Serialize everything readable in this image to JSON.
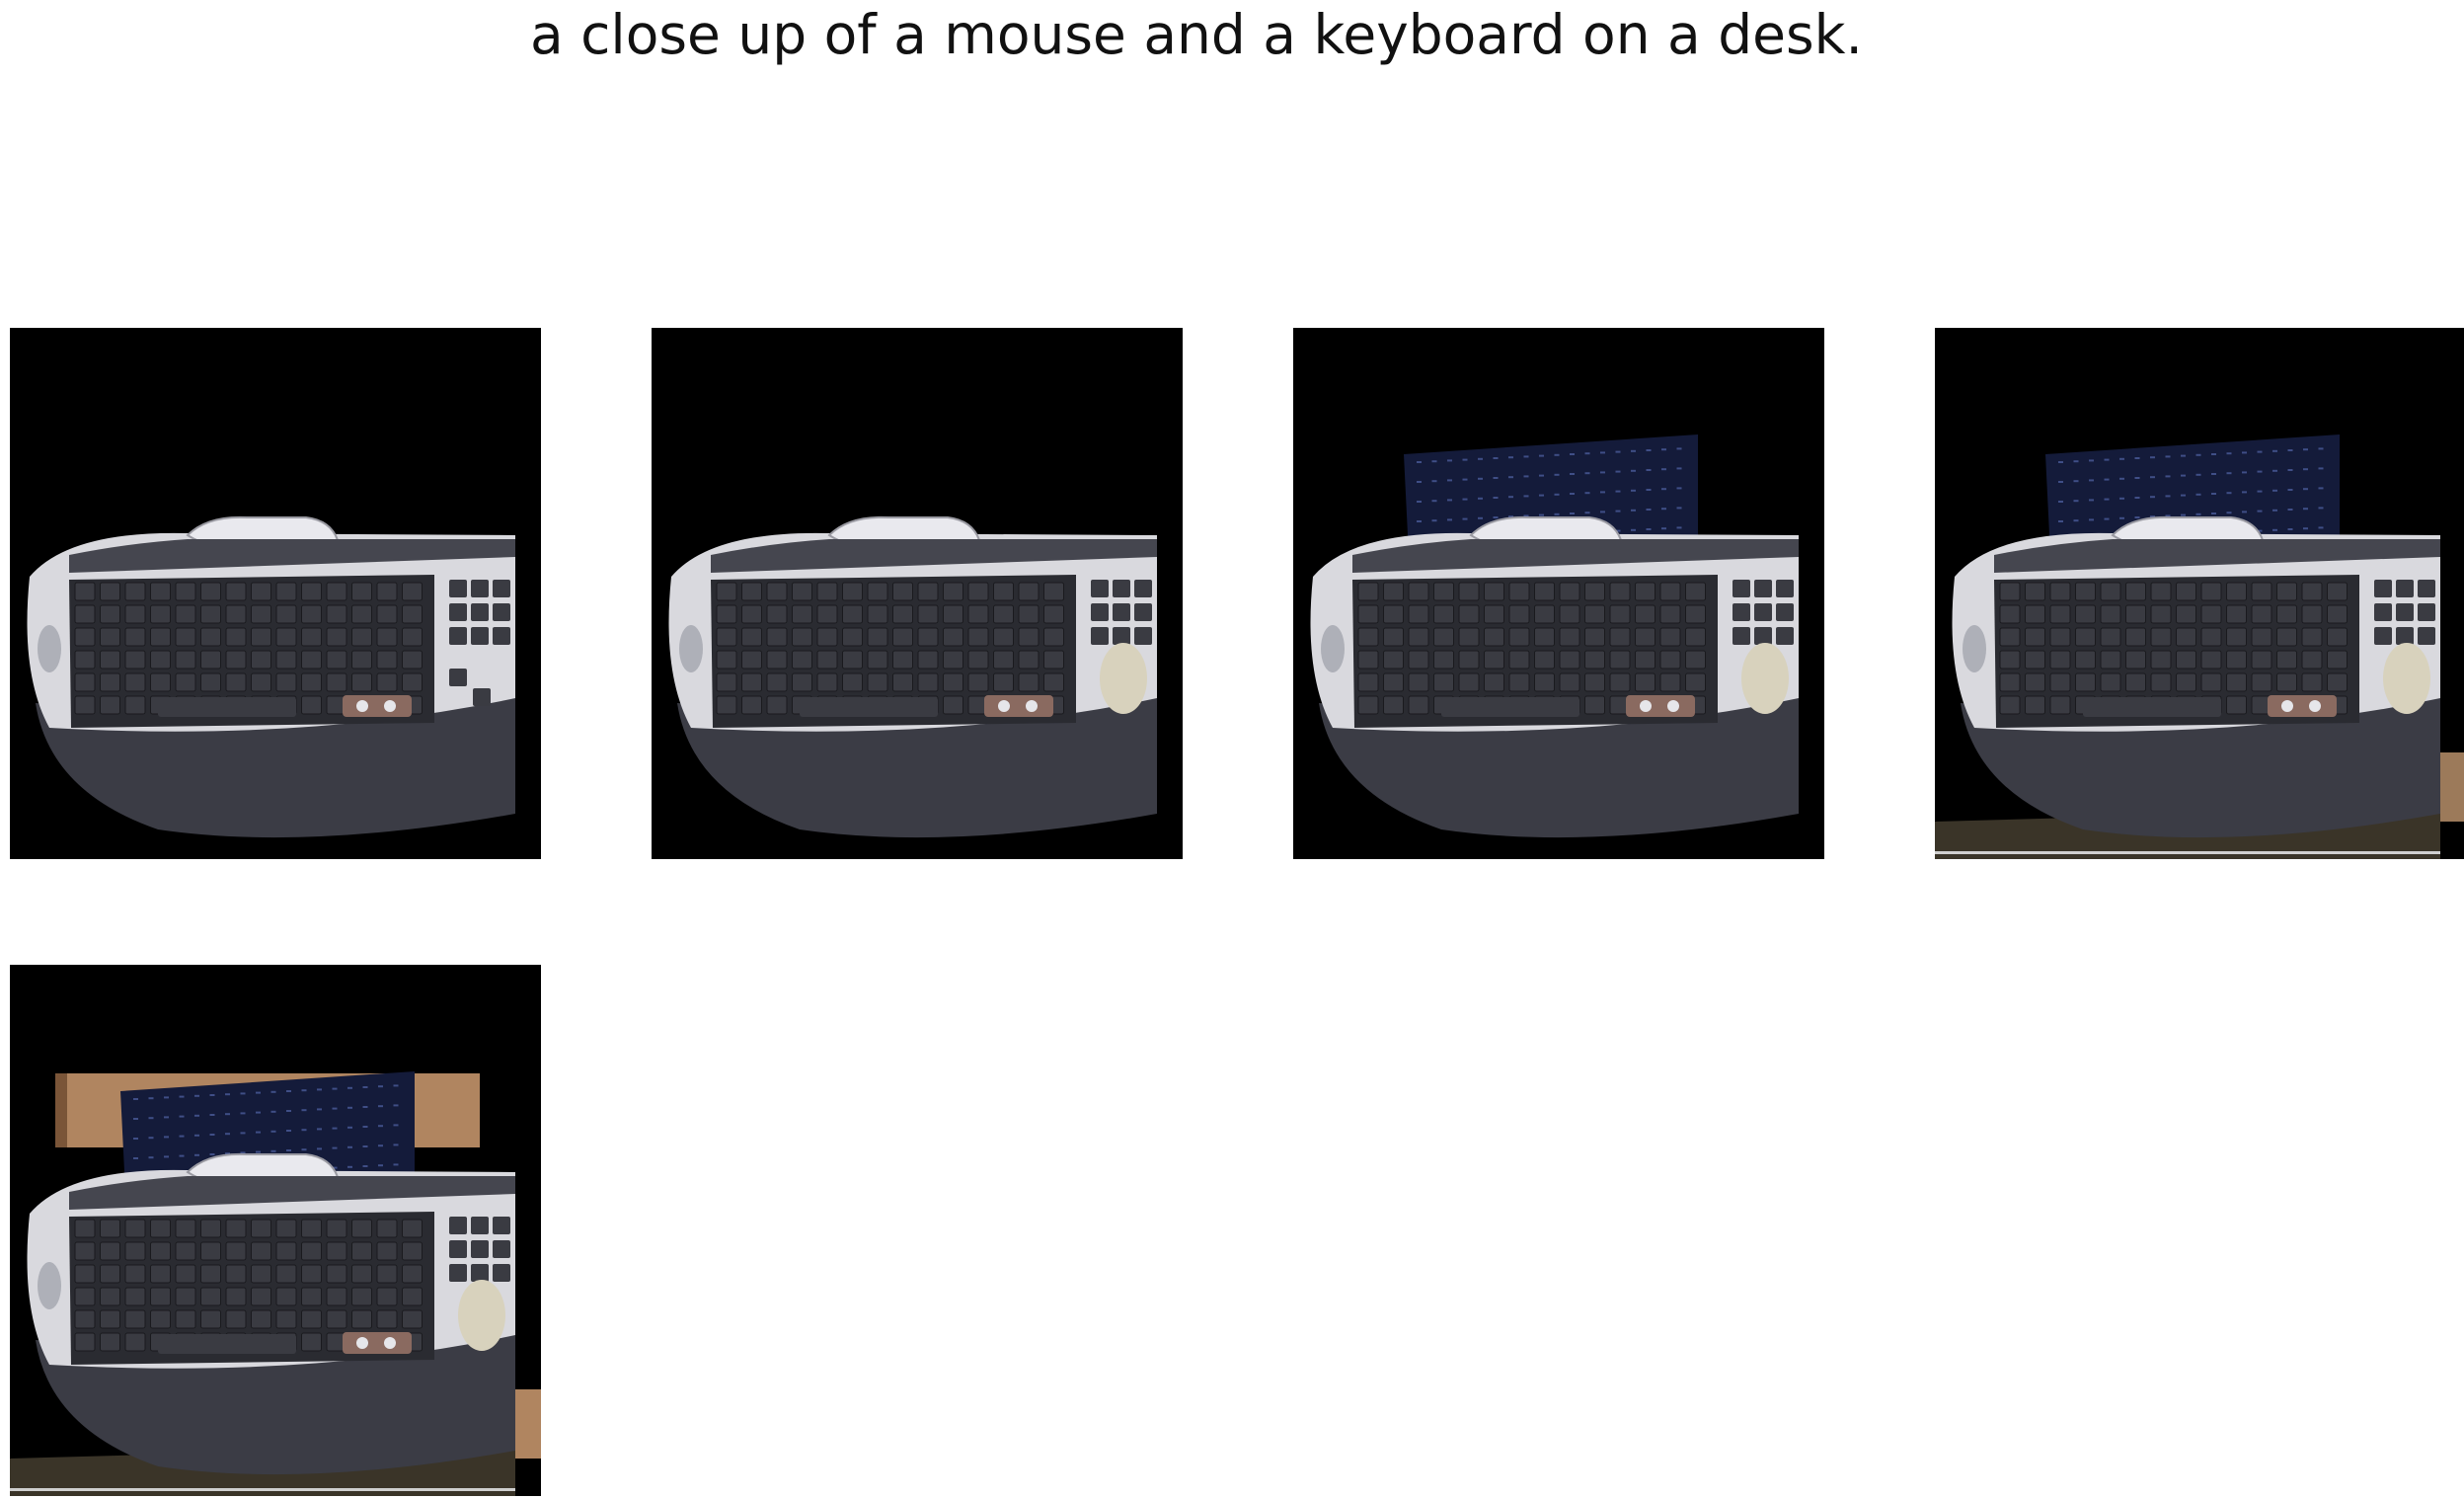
{
  "caption": "a close up of a mouse and a keyboard on a desk.",
  "panels": [
    {
      "id": "p1",
      "desk": false,
      "overlay": false,
      "wood": false,
      "mouse": false
    },
    {
      "id": "p2",
      "desk": false,
      "overlay": false,
      "wood": false,
      "mouse": true
    },
    {
      "id": "p3",
      "desk": false,
      "overlay": true,
      "wood": false,
      "mouse": true
    },
    {
      "id": "p4",
      "desk": true,
      "overlay": true,
      "wood": false,
      "mouse": true
    },
    {
      "id": "p5",
      "desk": true,
      "overlay": true,
      "wood": true,
      "mouse": true
    }
  ],
  "colors": {
    "background": "#000000",
    "keyboard_body": "#d9d9de",
    "keys": "#2a2b31",
    "palm_rest": "#3b3c45",
    "overlay": "#141b3a",
    "wood": "#b08560",
    "mouse": "#d8d2bd"
  }
}
